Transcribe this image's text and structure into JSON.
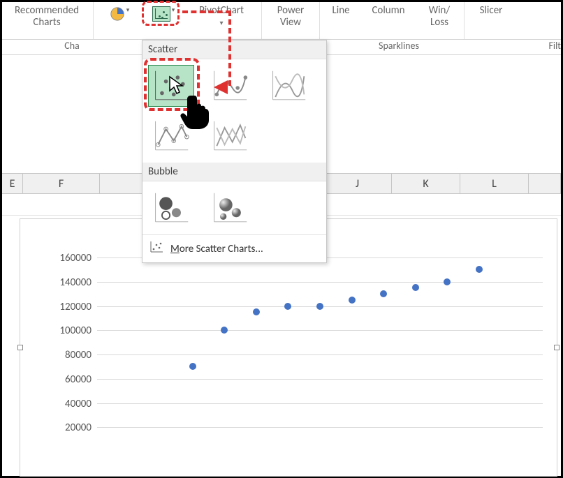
{
  "ribbon": {
    "recommendedCharts": "Recommended\nCharts",
    "pivotChart": "PivotChart",
    "powerView": "Power\nView",
    "line": "Line",
    "column": "Column",
    "winLoss": "Win/\nLoss",
    "slicer": "Slicer"
  },
  "groups": {
    "charts": "Cha",
    "sparklines": "Sparklines",
    "filters": "Filt"
  },
  "dropdown": {
    "scatterTitle": "Scatter",
    "bubbleTitle": "Bubble",
    "moreLabelPrefix": "M",
    "moreLabelRest": "ore Scatter Charts..."
  },
  "columns": [
    "E",
    "F",
    "",
    "",
    "J",
    "K",
    "L"
  ],
  "chart_data": {
    "type": "scatter",
    "title": "",
    "xlabel": "",
    "ylabel": "",
    "ylim": [
      0,
      160000
    ],
    "yticks": [
      20000,
      40000,
      60000,
      80000,
      100000,
      120000,
      140000,
      160000
    ],
    "x": [
      3,
      4,
      5,
      6,
      7,
      8,
      9,
      10,
      11,
      12
    ],
    "y": [
      70000,
      100000,
      115000,
      120000,
      120000,
      125000,
      130000,
      135000,
      140000,
      150000
    ]
  }
}
